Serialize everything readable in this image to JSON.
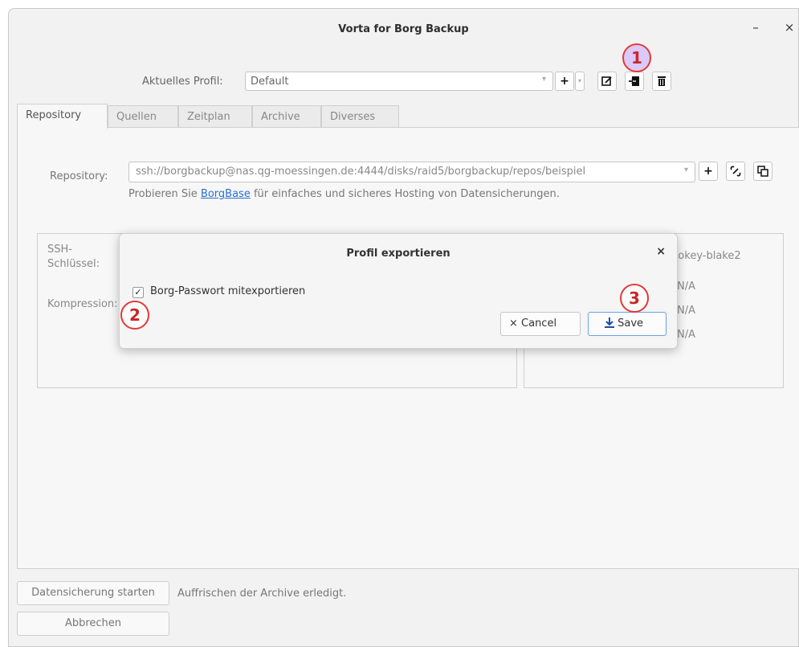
{
  "window": {
    "title": "Vorta for Borg Backup",
    "minimize": "–",
    "close": "×"
  },
  "profile": {
    "label": "Aktuelles Profil:",
    "selected": "Default",
    "add": "+",
    "edit": "✎",
    "export": "⇲",
    "delete": "🗑"
  },
  "tabs": [
    "Repository",
    "Quellen",
    "Zeitplan",
    "Archive",
    "Diverses"
  ],
  "repository": {
    "label": "Repository:",
    "value": "ssh://borgbackup@nas.qg-moessingen.de:4444/disks/raid5/borgbackup/repos/beispiel",
    "hint_prefix": "Probieren Sie ",
    "hint_link": "BorgBase",
    "hint_suffix": " für einfaches und sicheres Hosting von Datensicherungen.",
    "add": "+"
  },
  "left_group": {
    "ssh_label_1": "SSH-",
    "ssh_label_2": "Schlüssel:",
    "compression_label": "Kompression:"
  },
  "right_group": {
    "encryption_value": "repokey-blake2",
    "na1": "N/A",
    "na2": "N/A",
    "na3": "N/A"
  },
  "dialog": {
    "title": "Profil exportieren",
    "close": "×",
    "checkbox_label": "Borg-Passwort mitexportieren",
    "checkbox_mark": "✓",
    "cancel_label": "× Cancel",
    "save_label": "Save"
  },
  "badges": {
    "one": "1",
    "two": "2",
    "three": "3"
  },
  "bottom": {
    "start_button": "Datensicherung starten",
    "status": "Auffrischen der Archive erledigt.",
    "cancel_button": "Abbrechen"
  },
  "colors": {
    "link": "#2a6fd6",
    "badge_border": "#e53935",
    "save_border": "#6aa0e8"
  }
}
